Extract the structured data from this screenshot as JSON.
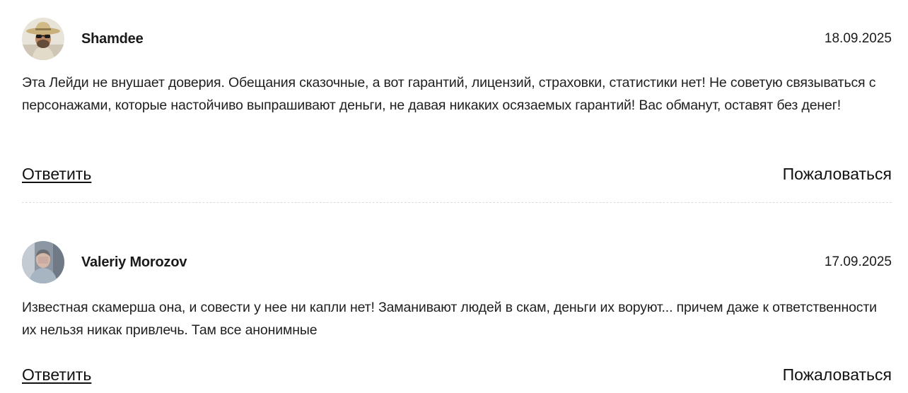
{
  "comments": [
    {
      "author": "Shamdee",
      "date": "18.09.2025",
      "text": "Эта Лейди не внушает доверия. Обещания сказочные, а вот гарантий, лицензий, страховки, статистики нет! Не советую связываться с персонажами, которые настойчиво выпрашивают деньги, не давая никаких осязаемых гарантий! Вас обманут, оставят без денег!",
      "reply_label": "Ответить",
      "report_label": "Пожаловаться"
    },
    {
      "author": "Valeriy Morozov",
      "date": "17.09.2025",
      "text": "Известная скамерша она, и совести у нее ни капли нет! Заманивают людей в скам, деньги их воруют... причем даже к ответственности их нельзя никак привлечь. Там все анонимные",
      "reply_label": "Ответить",
      "report_label": "Пожаловаться"
    }
  ]
}
